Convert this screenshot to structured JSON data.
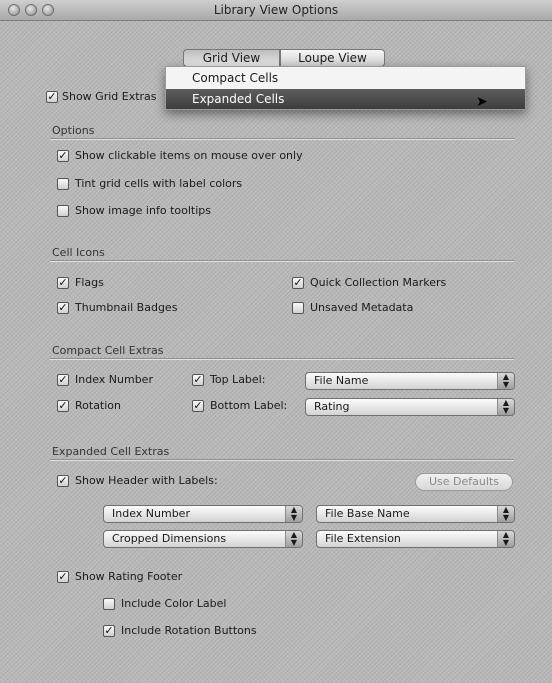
{
  "window": {
    "title": "Library View Options"
  },
  "tabs": [
    {
      "label": "Grid View"
    },
    {
      "label": "Loupe View"
    }
  ],
  "dropdown": {
    "items": [
      {
        "label": "Compact Cells"
      },
      {
        "label": "Expanded Cells"
      }
    ],
    "selected": "Expanded Cells"
  },
  "show_grid_extras": {
    "label": "Show Grid Extras",
    "checked": true
  },
  "options": {
    "title": "Options",
    "items": [
      {
        "label": "Show clickable items on mouse over only",
        "checked": true
      },
      {
        "label": "Tint grid cells with label colors",
        "checked": false
      },
      {
        "label": "Show image info tooltips",
        "checked": false
      }
    ]
  },
  "cell_icons": {
    "title": "Cell Icons",
    "items": [
      {
        "label": "Flags",
        "checked": true
      },
      {
        "label": "Quick Collection Markers",
        "checked": true
      },
      {
        "label": "Thumbnail Badges",
        "checked": true
      },
      {
        "label": "Unsaved Metadata",
        "checked": false
      }
    ]
  },
  "compact_extras": {
    "title": "Compact Cell Extras",
    "index_number": {
      "label": "Index Number",
      "checked": true
    },
    "rotation": {
      "label": "Rotation",
      "checked": true
    },
    "top_label": {
      "label": "Top Label:",
      "checked": true,
      "value": "File Name"
    },
    "bottom_label": {
      "label": "Bottom Label:",
      "checked": true,
      "value": "Rating"
    }
  },
  "expanded_extras": {
    "title": "Expanded Cell Extras",
    "show_header": {
      "label": "Show Header with Labels:",
      "checked": true
    },
    "use_defaults": "Use Defaults",
    "popups": [
      "Index Number",
      "File Base Name",
      "Cropped Dimensions",
      "File Extension"
    ],
    "show_rating_footer": {
      "label": "Show Rating Footer",
      "checked": true
    },
    "include_color_label": {
      "label": "Include Color Label",
      "checked": false
    },
    "include_rotation": {
      "label": "Include Rotation Buttons",
      "checked": true
    }
  }
}
